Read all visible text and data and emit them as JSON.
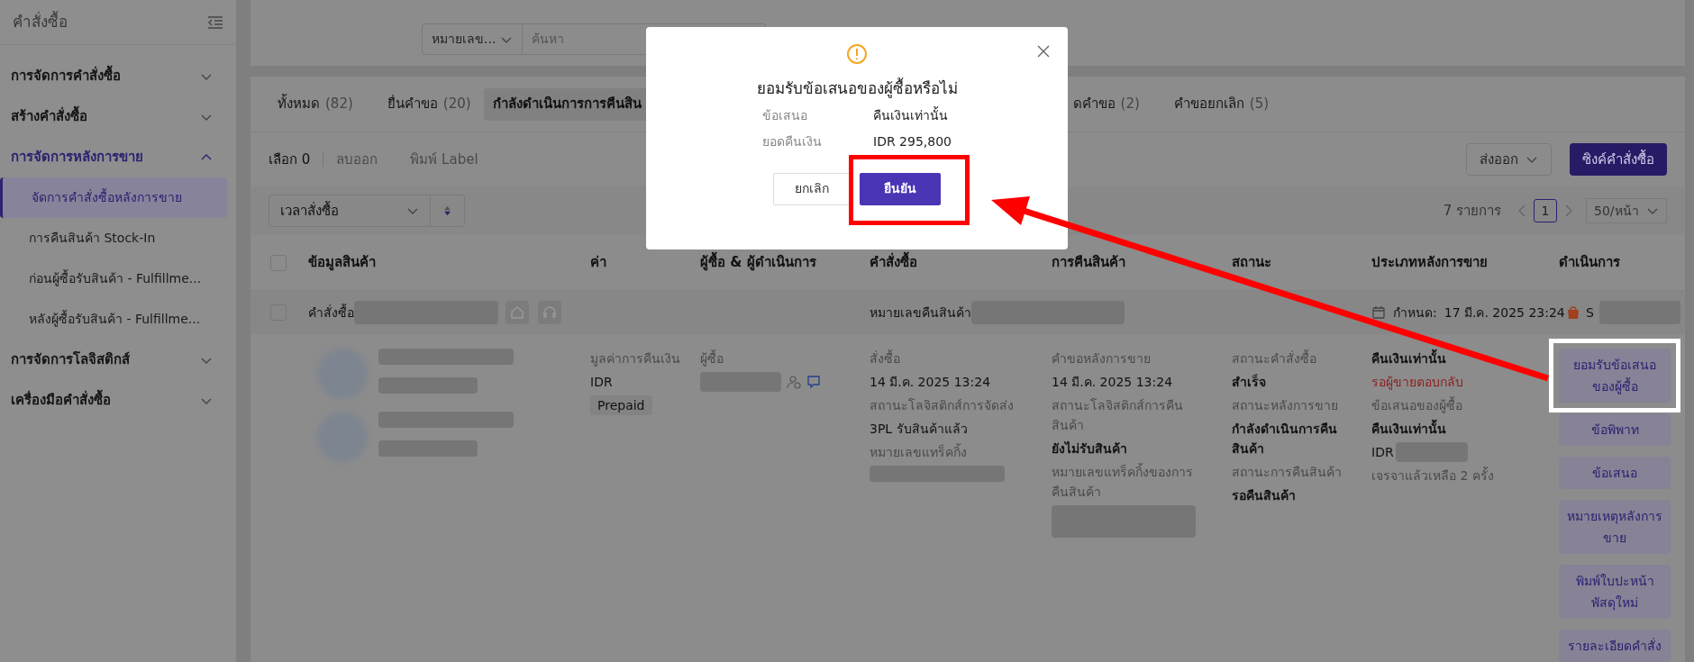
{
  "sidebar": {
    "title": "คำสั่งซื้อ",
    "items": [
      {
        "label": "การจัดการคำสั่งซื้อ",
        "expanded": false
      },
      {
        "label": "สร้างคำสั่งซื้อ",
        "expanded": false
      },
      {
        "label": "การจัดการหลังการขาย",
        "expanded": true,
        "children": [
          {
            "label": "จัดการคำสั่งซื้อหลังการขาย",
            "selected": true
          },
          {
            "label": "การคืนสินค้า Stock-In",
            "selected": false
          },
          {
            "label": "ก่อนผู้ซื้อรับสินค้า - Fulfillme...",
            "selected": false
          },
          {
            "label": "หลังผู้ซื้อรับสินค้า - Fulfillme...",
            "selected": false
          }
        ]
      },
      {
        "label": "การจัดการโลจิสติกส์",
        "expanded": false
      },
      {
        "label": "เครื่องมือคำสั่งซื้อ",
        "expanded": false
      }
    ]
  },
  "search": {
    "type_select": "หมายเลข...",
    "placeholder": "ค้นหา"
  },
  "tabs": [
    {
      "label": "ทั้งหมด",
      "count": "(82)",
      "selected": false
    },
    {
      "label": "ยื่นคำขอ",
      "count": "(20)",
      "selected": false
    },
    {
      "label": "กำลังดำเนินการการคืนสิน",
      "selected": true
    },
    {
      "label": "ดคำขอ",
      "count": "(2)",
      "selected": false
    },
    {
      "label": "คำขอยกเลิก",
      "count": "(5)",
      "selected": false
    }
  ],
  "toolbar": {
    "selected": "เลือก 0",
    "remove": "ลบออก",
    "print": "พิมพ์ Label",
    "export": "ส่งออก",
    "sync": "ซิงค์คำสั่งซื้อ"
  },
  "sort": {
    "value": "เวลาสั่งซื้อ"
  },
  "pagination": {
    "total": "7 รายการ",
    "page": "1",
    "per_page": "50/หน้า"
  },
  "table": {
    "columns": [
      "ข้อมูลสินค้า",
      "ค่า",
      "ผู้ซื้อ & ผู้ดำเนินการ",
      "คำสั่งซื้อ",
      "การคืนสินค้า",
      "สถานะ",
      "ประเภทหลังการขาย",
      "ดำเนินการ"
    ],
    "header_checked": false,
    "order_row": {
      "checked": false,
      "order_label": "คำสั่งซื้อ",
      "return_label": "หมายเลขคืนสินค้า",
      "deadline_label": "กำหนด:",
      "deadline": "17 มี.ค. 2025 23:24",
      "shop_initial": "S"
    },
    "detail": {
      "amount": [
        {
          "text": "มูลค่าการคืนเงิน",
          "kind": "label"
        },
        {
          "text": "IDR",
          "kind": "value"
        }
      ],
      "payment_tag": "Prepaid",
      "buyer_label": "ผู้ซื้อ",
      "order": [
        {
          "text": "สั่งซื้อ",
          "kind": "label"
        },
        {
          "text": "14 มี.ค. 2025 13:24",
          "kind": "value"
        },
        {
          "text": "สถานะโลจิสติกส์การจัดส่ง",
          "kind": "label"
        },
        {
          "text": "3PL รับสินค้าแล้ว",
          "kind": "value"
        },
        {
          "text": "หมายเลขแทร็คกิ้ง",
          "kind": "label"
        }
      ],
      "return": [
        {
          "text": "คำขอหลังการขาย",
          "kind": "label"
        },
        {
          "text": "14 มี.ค. 2025 13:24",
          "kind": "value"
        },
        {
          "text": "สถานะโลจิสติกส์การคืนสินค้า",
          "kind": "label"
        },
        {
          "text": "ยังไม่รับสินค้า",
          "kind": "strong"
        },
        {
          "text": "หมายเลขแทร็คกิ้งของการคืนสินค้า",
          "kind": "label"
        }
      ],
      "status": [
        {
          "text": "สถานะคำสั่งซื้อ",
          "kind": "label"
        },
        {
          "text": "สำเร็จ",
          "kind": "strong"
        },
        {
          "text": "สถานะหลังการขาย",
          "kind": "label"
        },
        {
          "text": "กำลังดำเนินการคืนสินค้า",
          "kind": "strong"
        },
        {
          "text": "สถานะการคืนสินค้า",
          "kind": "label"
        },
        {
          "text": "รอคืนสินค้า",
          "kind": "strong"
        }
      ],
      "type": [
        {
          "text": "คืนเงินเท่านั้น",
          "kind": "strong"
        },
        {
          "text": "รอผู้ขายตอบกลับ",
          "kind": "alert"
        },
        {
          "text": "ข้อเสนอของผู้ซื้อ",
          "kind": "label"
        },
        {
          "text": "คืนเงินเท่านั้น",
          "kind": "strong"
        },
        {
          "text": "IDR",
          "kind": "value"
        },
        {
          "text": "เจรจาแล้วเหลือ 2 ครั้ง",
          "kind": "label"
        }
      ],
      "actions": [
        {
          "label": "ยอมรับข้อเสนอของผู้ซื้อ",
          "highlighted": true
        },
        {
          "label": "ข้อพิพาท",
          "highlighted": false
        },
        {
          "label": "ข้อเสนอ",
          "highlighted": false
        },
        {
          "label": "หมายเหตุหลังการขาย",
          "highlighted": false
        },
        {
          "label": "พิมพ์ใบปะหน้าพัสดุใหม่",
          "highlighted": false
        },
        {
          "label": "รายละเอียดคำสั่ง",
          "highlighted": false
        }
      ]
    }
  },
  "dialog": {
    "title": "ยอมรับข้อเสนอของผู้ซื้อหรือไม่",
    "fields": [
      {
        "label": "ข้อเสนอ",
        "value": "คืนเงินเท่านั้น"
      },
      {
        "label": "ยอดคืนเงิน",
        "value": "IDR 295,800"
      }
    ],
    "cancel": "ยกเลิก",
    "confirm": "ยืนยัน",
    "confirm_highlighted": true
  }
}
